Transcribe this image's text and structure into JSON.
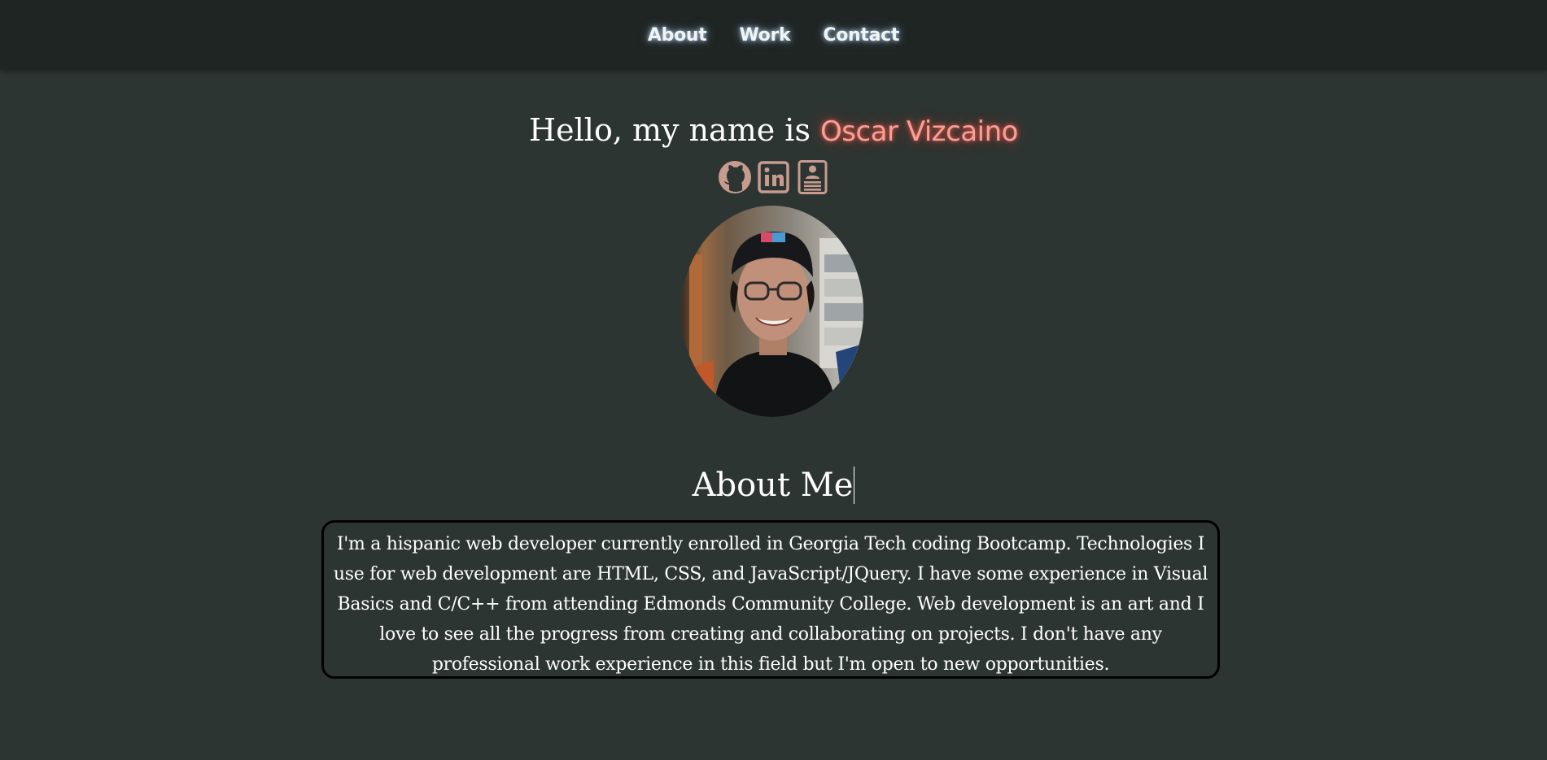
{
  "nav": {
    "items": [
      {
        "label": "About"
      },
      {
        "label": "Work"
      },
      {
        "label": "Contact"
      }
    ]
  },
  "hero": {
    "greeting": "Hello, my name is ",
    "name": "Oscar Vizcaino",
    "name_color": "#f5a09a",
    "socials": [
      {
        "icon": "github-icon"
      },
      {
        "icon": "linkedin-icon"
      },
      {
        "icon": "resume-icon"
      }
    ]
  },
  "about": {
    "heading": "About Me",
    "text": "I'm a hispanic web developer currently enrolled in Georgia Tech coding Bootcamp. Technologies I use for web development are HTML, CSS, and JavaScript/JQuery. I have some experience in Visual Basics and C/C++ from attending Edmonds Community College. Web development is an art and I love to see all the progress from creating and collaborating on projects. I don't have any professional work experience in this field but I'm open to new opportunities."
  },
  "colors": {
    "background": "#2d3532",
    "navbar": "#1f2523",
    "accent": "#f5a09a",
    "icon": "#c89b8f"
  }
}
